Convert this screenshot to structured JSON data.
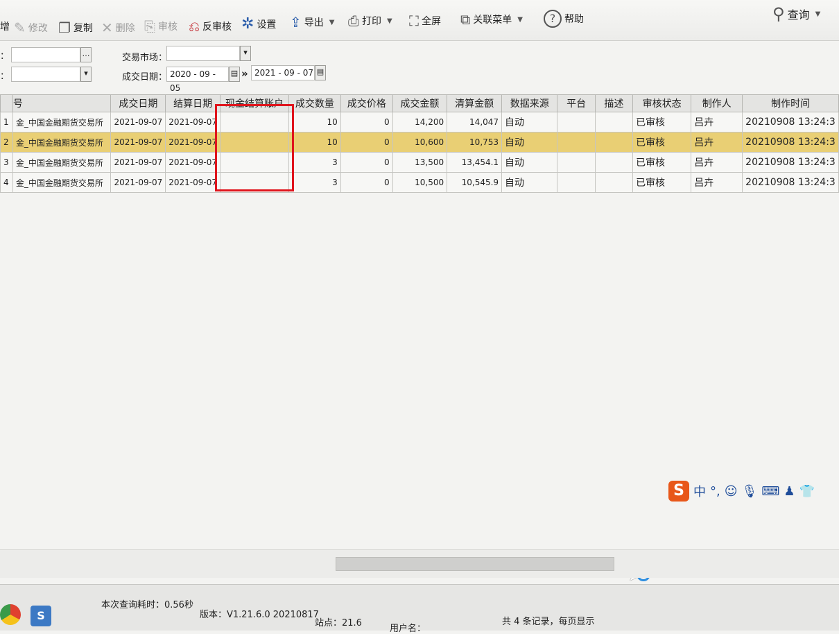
{
  "toolbar": {
    "add": "增",
    "edit": "修改",
    "copy": "复制",
    "delete": "删除",
    "audit": "审核",
    "unaudit": "反审核",
    "settings": "设置",
    "export": "导出",
    "print": "打印",
    "fullscreen": "全屏",
    "related_menu": "关联菜单",
    "help": "帮助",
    "query": "查询"
  },
  "filters": {
    "row1_label": "：",
    "row2_label": "：",
    "market_label": "交易市场：",
    "market_value": "",
    "date_label": "成交日期：",
    "date_from": "2020 - 09 - 05",
    "date_to": "2021 - 09 - 07",
    "range_sep": "»"
  },
  "table": {
    "headers": [
      "号",
      "成交日期",
      "结算日期",
      "现金结算账户",
      "成交数量",
      "成交价格",
      "成交金额",
      "清算金额",
      "数据来源",
      "平台",
      "描述",
      "审核状态",
      "制作人",
      "制作时间"
    ],
    "rows": [
      {
        "idx": "1",
        "name": "金_中国金融期货交易所",
        "trade_date": "2021-09-07",
        "settle_date": "2021-09-07",
        "account": "",
        "qty": "10",
        "price": "0",
        "amount": "14,200",
        "clear": "14,047",
        "source": "自动",
        "platform": "",
        "desc": "",
        "status": "已审核",
        "maker": "吕卉",
        "time": "20210908 13:24:3"
      },
      {
        "idx": "2",
        "name": "金_中国金融期货交易所",
        "trade_date": "2021-09-07",
        "settle_date": "2021-09-07",
        "account": "",
        "qty": "10",
        "price": "0",
        "amount": "10,600",
        "clear": "10,753",
        "source": "自动",
        "platform": "",
        "desc": "",
        "status": "已审核",
        "maker": "吕卉",
        "time": "20210908 13:24:3"
      },
      {
        "idx": "3",
        "name": "金_中国金融期货交易所",
        "trade_date": "2021-09-07",
        "settle_date": "2021-09-07",
        "account": "",
        "qty": "3",
        "price": "0",
        "amount": "13,500",
        "clear": "13,454.1",
        "source": "自动",
        "platform": "",
        "desc": "",
        "status": "已审核",
        "maker": "吕卉",
        "time": "20210908 13:24:3"
      },
      {
        "idx": "4",
        "name": "金_中国金融期货交易所",
        "trade_date": "2021-09-07",
        "settle_date": "2021-09-07",
        "account": "",
        "qty": "3",
        "price": "0",
        "amount": "10,500",
        "clear": "10,545.9",
        "source": "自动",
        "platform": "",
        "desc": "",
        "status": "已审核",
        "maker": "吕卉",
        "time": "20210908 13:24:3"
      }
    ],
    "selected_row": 1
  },
  "ime": {
    "mode": "中",
    "punct": "°,"
  },
  "status": {
    "query_time": "本次查询耗时：0.56秒",
    "version": "版本：V1.21.6.0 20210817",
    "site": "站点：21.6",
    "user": "用户名：",
    "records": "共 4 条记录，每页显示"
  },
  "colors": {
    "selected_row": "#e9cf74",
    "highlight_box": "#e0141c",
    "toolbar_bg": "#f0f0ee"
  }
}
